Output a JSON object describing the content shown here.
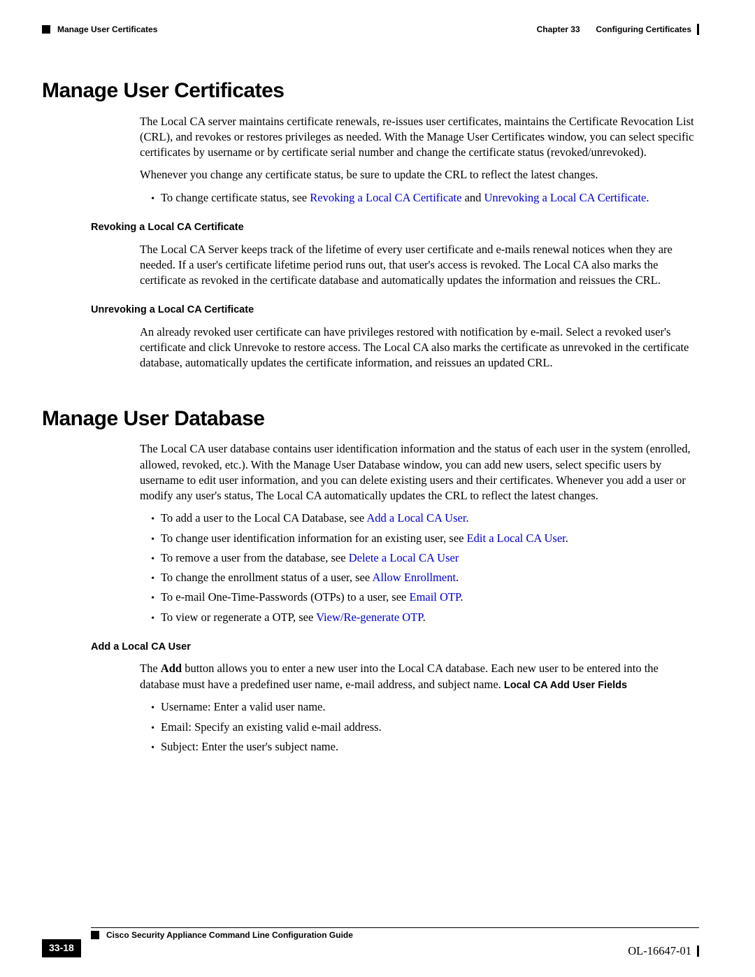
{
  "header": {
    "breadcrumb_left": "Manage User Certificates",
    "chapter_label": "Chapter 33",
    "chapter_title": "Configuring Certificates"
  },
  "section1": {
    "title": "Manage User Certificates",
    "p1": "The Local CA server maintains certificate renewals, re-issues user certificates, maintains the Certificate Revocation List (CRL), and revokes or restores privileges as needed. With the Manage User Certificates window, you can select specific certificates by username or by certificate serial number and change the certificate status (revoked/unrevoked).",
    "p2": "Whenever you change any certificate status, be sure to update the CRL to reflect the latest changes.",
    "bullet_prefix": "To change certificate status, see ",
    "link1": "Revoking a Local CA Certificate",
    "and": " and ",
    "link2": "Unrevoking a Local CA Certificate",
    "period": ".",
    "sub1_title": "Revoking a Local CA Certificate",
    "sub1_body": "The Local CA Server keeps track of the lifetime of every user certificate and e-mails renewal notices when they are needed. If a user's certificate lifetime period runs out, that user's access is revoked. The Local CA also marks the certificate as revoked in the certificate database and automatically updates the information and reissues the CRL.",
    "sub2_title": "Unrevoking a Local CA Certificate",
    "sub2_body": "An already revoked user certificate can have privileges restored with notification by e-mail. Select a revoked user's certificate and click Unrevoke to restore access. The Local CA also marks the certificate as unrevoked in the certificate database, automatically updates the certificate information, and reissues an updated CRL."
  },
  "section2": {
    "title": "Manage User Database",
    "p1": "The Local CA user database contains user identification information and the status of each user in the system (enrolled, allowed, revoked, etc.). With the Manage User Database window, you can add new users, select specific users by username to edit user information, and you can delete existing users and their certificates. Whenever you add a user or modify any user's status, The Local CA automatically updates the CRL to reflect the latest changes.",
    "bullets": {
      "b1a": "To add a user to the Local CA Database, see ",
      "b1l": "Add a Local CA User",
      "b1b": ".",
      "b2a": "To change user identification information for an existing user, see ",
      "b2l": "Edit a Local CA User",
      "b2b": ".",
      "b3a": "To remove a user from the database, see ",
      "b3l": "Delete a Local CA User",
      "b3b": "",
      "b4a": "To change the enrollment status of a user, see ",
      "b4l": "Allow Enrollment",
      "b4b": ".",
      "b5a": "To e-mail One-Time-Passwords (OTPs) to a user, see ",
      "b5l": "Email OTP",
      "b5b": ".",
      "b6a": "To view or regenerate a OTP, see ",
      "b6l": "View/Re-generate OTP",
      "b6b": "."
    },
    "sub1_title": "Add a Local CA User",
    "sub1_p_a": "The ",
    "sub1_p_bold": "Add",
    "sub1_p_b": " button allows you to enter a new user into the Local CA database. Each new user to be entered into the database must have a predefined user name, e-mail address, and subject name. ",
    "sub1_p_sans": "Local CA Add User Fields",
    "sub1_bullets": {
      "b1": "Username: Enter a valid user name.",
      "b2": "Email: Specify an existing valid e-mail address.",
      "b3": "Subject: Enter the user's subject name."
    }
  },
  "footer": {
    "guide_title": "Cisco Security Appliance Command Line Configuration Guide",
    "page_number": "33-18",
    "doc_id": "OL-16647-01"
  }
}
